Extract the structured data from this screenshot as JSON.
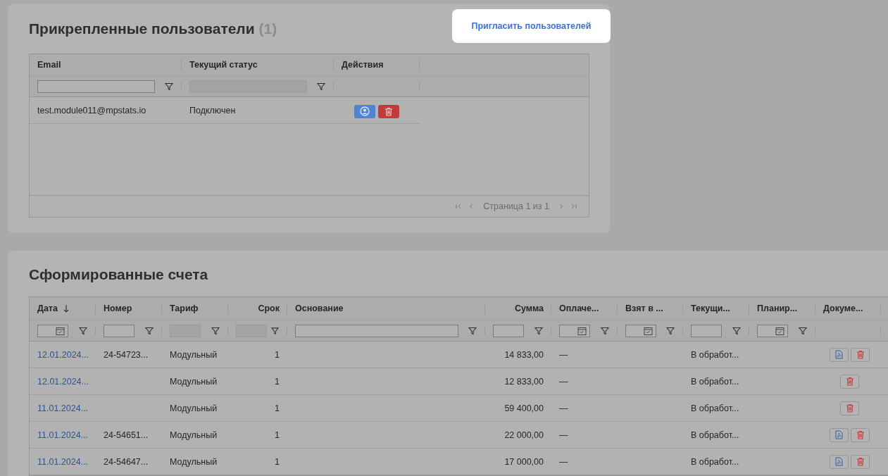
{
  "users_panel": {
    "title": "Прикрепленные пользователи",
    "count": "(1)",
    "invite_button": "Пригласить пользователей",
    "table": {
      "columns": [
        {
          "label": "Email",
          "kind": "text"
        },
        {
          "label": "Текущий статус",
          "kind": "disabled"
        },
        {
          "label": "Действия",
          "kind": "none"
        }
      ],
      "rows": [
        {
          "email": "test.module011@mpstats.io",
          "status": "Подключен"
        }
      ],
      "pagination": "Страница 1 из 1"
    }
  },
  "invoices_panel": {
    "title": "Сформированные счета",
    "table": {
      "columns": [
        {
          "label": "Дата",
          "kind": "date",
          "sorted": true
        },
        {
          "label": "Номер",
          "kind": "text",
          "sorted": false
        },
        {
          "label": "Тариф",
          "kind": "disabled",
          "sorted": false
        },
        {
          "label": "Срок",
          "kind": "disabled-numeric",
          "sorted": false
        },
        {
          "label": "Основание",
          "kind": "text",
          "sorted": false
        },
        {
          "label": "Сумма",
          "kind": "numeric",
          "sorted": false
        },
        {
          "label": "Оплаче...",
          "kind": "date",
          "sorted": false
        },
        {
          "label": "Взят в ...",
          "kind": "date",
          "sorted": false
        },
        {
          "label": "Текущи...",
          "kind": "text",
          "sorted": false
        },
        {
          "label": "Планир...",
          "kind": "date",
          "sorted": false
        },
        {
          "label": "Докуме...",
          "kind": "none",
          "sorted": false
        }
      ],
      "rows": [
        {
          "date": "12.01.2024...",
          "number": "24-54723...",
          "tariff": "Модульный",
          "term": "1",
          "sum": "14 833,00",
          "paid": "—",
          "status": "В обработ...",
          "has_pdf": true
        },
        {
          "date": "12.01.2024...",
          "tariff": "Модульный",
          "term": "1",
          "sum": "12 833,00",
          "paid": "—",
          "status": "В обработ...",
          "has_pdf": false
        },
        {
          "date": "11.01.2024...",
          "tariff": "Модульный",
          "term": "1",
          "sum": "59 400,00",
          "paid": "—",
          "status": "В обработ...",
          "has_pdf": false
        },
        {
          "date": "11.01.2024...",
          "number": "24-54651...",
          "tariff": "Модульный",
          "term": "1",
          "sum": "22 000,00",
          "paid": "—",
          "status": "В обработ...",
          "has_pdf": true
        },
        {
          "date": "11.01.2024...",
          "number": "24-54647...",
          "tariff": "Модульный",
          "term": "1",
          "sum": "17 000,00",
          "paid": "—",
          "status": "В обработ...",
          "has_pdf": true
        }
      ]
    }
  }
}
